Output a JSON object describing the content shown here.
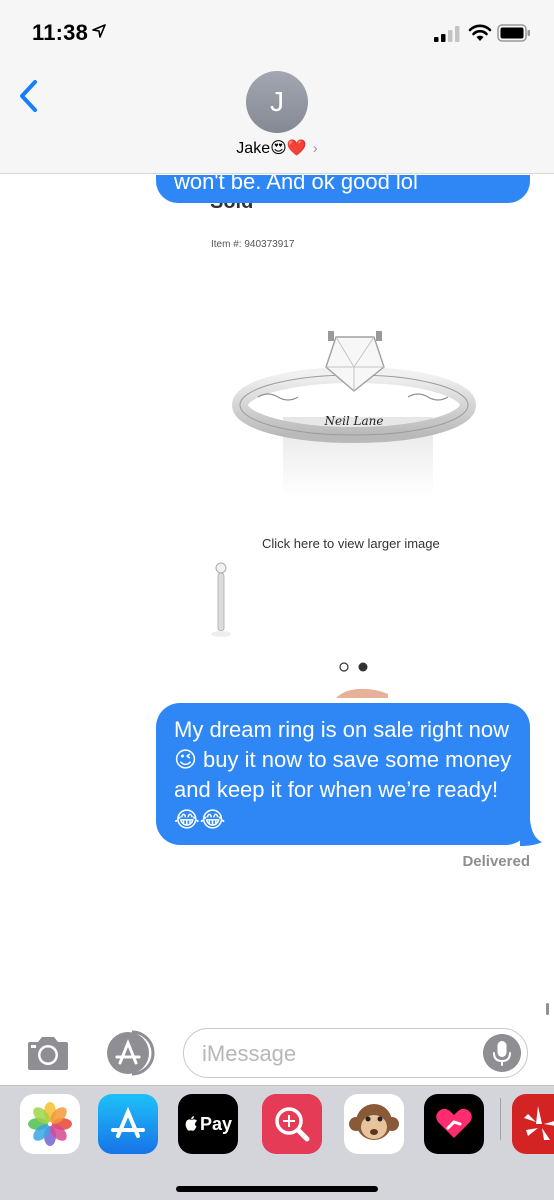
{
  "status_bar": {
    "time": "11:38",
    "icons": [
      "location-arrow-icon",
      "signal-icon",
      "wifi-icon",
      "battery-icon"
    ]
  },
  "header": {
    "avatar_initial": "J",
    "contact_name": "Jake😍❤️",
    "contact_chevron": "›"
  },
  "conversation": {
    "previous_bubble_text": "won't be. And ok good lol",
    "shared_image": {
      "item_number": "Item #: 940373917",
      "brand_engraving": "Neil Lane",
      "view_larger_text": "Click here to view larger image",
      "carousel_page": 2,
      "carousel_total": 2
    },
    "message": {
      "text": "My dream ring is on sale right now😉 buy it now to save some money and keep it for when we’re ready! 😂😂",
      "status": "Delivered"
    }
  },
  "input": {
    "placeholder": "iMessage"
  },
  "app_drawer": {
    "apps": [
      {
        "name": "photos-app-icon"
      },
      {
        "name": "app-store-icon"
      },
      {
        "name": "apple-pay-icon",
        "label": "Pay"
      },
      {
        "name": "search-images-icon"
      },
      {
        "name": "animoji-monkey-icon"
      },
      {
        "name": "digital-touch-icon"
      },
      {
        "name": "yelp-icon"
      }
    ]
  },
  "colors": {
    "bubble_blue": "#2e87f4",
    "header_bg": "#f6f6f6",
    "drawer_bg": "#d3d5db",
    "ios_blue": "#147efb"
  }
}
